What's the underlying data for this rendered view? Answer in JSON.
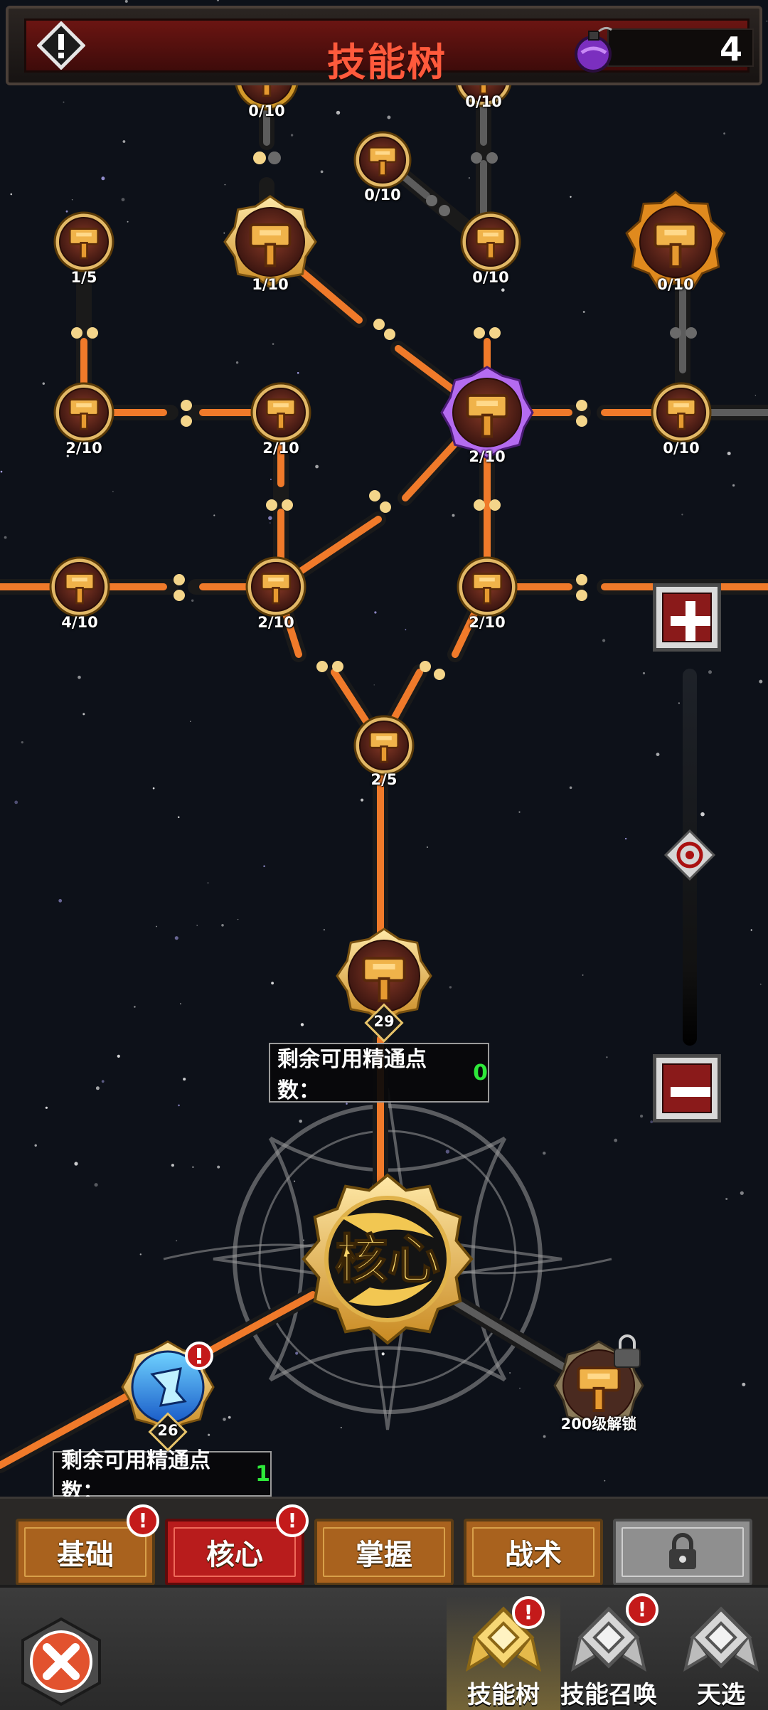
{
  "header": {
    "title": "技能树",
    "currency_count": "4",
    "alert_icon": "alert-icon",
    "currency_icon": "potion-icon"
  },
  "nodes": [
    {
      "id": "n_top_left",
      "label": "0/10"
    },
    {
      "id": "n_top_right",
      "label": "0/10"
    },
    {
      "id": "n_mid_small",
      "label": "0/10"
    },
    {
      "id": "n_r2_left",
      "label": "1/5"
    },
    {
      "id": "n_r2_gold",
      "label": "1/10"
    },
    {
      "id": "n_r2_mid",
      "label": "0/10"
    },
    {
      "id": "n_r2_orange",
      "label": "0/10"
    },
    {
      "id": "n_r3_a",
      "label": "2/10"
    },
    {
      "id": "n_r3_b",
      "label": "2/10"
    },
    {
      "id": "n_r3_purple",
      "label": "2/10"
    },
    {
      "id": "n_r3_d",
      "label": "0/10"
    },
    {
      "id": "n_r4_a",
      "label": "4/10"
    },
    {
      "id": "n_r4_b",
      "label": "2/10"
    },
    {
      "id": "n_r4_c",
      "label": "2/10"
    },
    {
      "id": "n_r5",
      "label": "2/5"
    },
    {
      "id": "n_core_top",
      "label": "29"
    },
    {
      "id": "n_left_blue",
      "label": "26"
    },
    {
      "id": "n_locked",
      "label": "200级解锁"
    }
  ],
  "core": {
    "label": "核心"
  },
  "points_primary": {
    "label": "剩余可用精通点数：",
    "value": "0"
  },
  "points_secondary": {
    "label": "剩余可用精通点数：",
    "value": "1"
  },
  "tabs": [
    {
      "label": "基础",
      "badge": "!"
    },
    {
      "label": "核心",
      "badge": "!",
      "active": true
    },
    {
      "label": "掌握"
    },
    {
      "label": "战术"
    },
    {
      "label": "",
      "icon": "lock-icon",
      "locked": true
    }
  ],
  "nav": [
    {
      "label": "技能树",
      "badge": "!",
      "active": true
    },
    {
      "label": "技能召唤",
      "badge": "!"
    },
    {
      "label": "天选"
    }
  ],
  "colors": {
    "accent_title": "#ff5a3c",
    "path_active": "#f07a2a",
    "path_inactive": "#5c5c5c",
    "points_value": "#2ee83a",
    "tab_active": "#b81c1c",
    "tab_default": "#a9621e"
  }
}
